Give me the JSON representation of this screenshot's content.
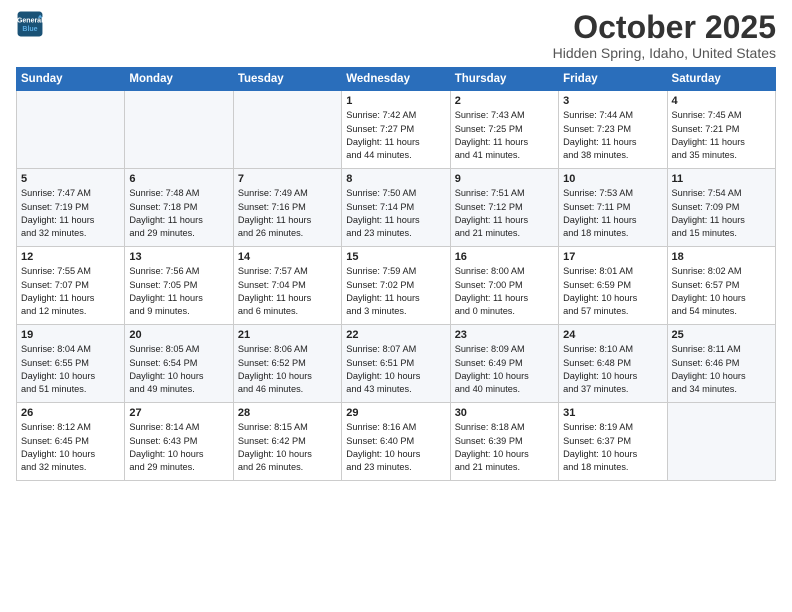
{
  "header": {
    "logo_line1": "General",
    "logo_line2": "Blue",
    "month": "October 2025",
    "location": "Hidden Spring, Idaho, United States"
  },
  "weekdays": [
    "Sunday",
    "Monday",
    "Tuesday",
    "Wednesday",
    "Thursday",
    "Friday",
    "Saturday"
  ],
  "weeks": [
    [
      {
        "day": "",
        "info": ""
      },
      {
        "day": "",
        "info": ""
      },
      {
        "day": "",
        "info": ""
      },
      {
        "day": "1",
        "info": "Sunrise: 7:42 AM\nSunset: 7:27 PM\nDaylight: 11 hours\nand 44 minutes."
      },
      {
        "day": "2",
        "info": "Sunrise: 7:43 AM\nSunset: 7:25 PM\nDaylight: 11 hours\nand 41 minutes."
      },
      {
        "day": "3",
        "info": "Sunrise: 7:44 AM\nSunset: 7:23 PM\nDaylight: 11 hours\nand 38 minutes."
      },
      {
        "day": "4",
        "info": "Sunrise: 7:45 AM\nSunset: 7:21 PM\nDaylight: 11 hours\nand 35 minutes."
      }
    ],
    [
      {
        "day": "5",
        "info": "Sunrise: 7:47 AM\nSunset: 7:19 PM\nDaylight: 11 hours\nand 32 minutes."
      },
      {
        "day": "6",
        "info": "Sunrise: 7:48 AM\nSunset: 7:18 PM\nDaylight: 11 hours\nand 29 minutes."
      },
      {
        "day": "7",
        "info": "Sunrise: 7:49 AM\nSunset: 7:16 PM\nDaylight: 11 hours\nand 26 minutes."
      },
      {
        "day": "8",
        "info": "Sunrise: 7:50 AM\nSunset: 7:14 PM\nDaylight: 11 hours\nand 23 minutes."
      },
      {
        "day": "9",
        "info": "Sunrise: 7:51 AM\nSunset: 7:12 PM\nDaylight: 11 hours\nand 21 minutes."
      },
      {
        "day": "10",
        "info": "Sunrise: 7:53 AM\nSunset: 7:11 PM\nDaylight: 11 hours\nand 18 minutes."
      },
      {
        "day": "11",
        "info": "Sunrise: 7:54 AM\nSunset: 7:09 PM\nDaylight: 11 hours\nand 15 minutes."
      }
    ],
    [
      {
        "day": "12",
        "info": "Sunrise: 7:55 AM\nSunset: 7:07 PM\nDaylight: 11 hours\nand 12 minutes."
      },
      {
        "day": "13",
        "info": "Sunrise: 7:56 AM\nSunset: 7:05 PM\nDaylight: 11 hours\nand 9 minutes."
      },
      {
        "day": "14",
        "info": "Sunrise: 7:57 AM\nSunset: 7:04 PM\nDaylight: 11 hours\nand 6 minutes."
      },
      {
        "day": "15",
        "info": "Sunrise: 7:59 AM\nSunset: 7:02 PM\nDaylight: 11 hours\nand 3 minutes."
      },
      {
        "day": "16",
        "info": "Sunrise: 8:00 AM\nSunset: 7:00 PM\nDaylight: 11 hours\nand 0 minutes."
      },
      {
        "day": "17",
        "info": "Sunrise: 8:01 AM\nSunset: 6:59 PM\nDaylight: 10 hours\nand 57 minutes."
      },
      {
        "day": "18",
        "info": "Sunrise: 8:02 AM\nSunset: 6:57 PM\nDaylight: 10 hours\nand 54 minutes."
      }
    ],
    [
      {
        "day": "19",
        "info": "Sunrise: 8:04 AM\nSunset: 6:55 PM\nDaylight: 10 hours\nand 51 minutes."
      },
      {
        "day": "20",
        "info": "Sunrise: 8:05 AM\nSunset: 6:54 PM\nDaylight: 10 hours\nand 49 minutes."
      },
      {
        "day": "21",
        "info": "Sunrise: 8:06 AM\nSunset: 6:52 PM\nDaylight: 10 hours\nand 46 minutes."
      },
      {
        "day": "22",
        "info": "Sunrise: 8:07 AM\nSunset: 6:51 PM\nDaylight: 10 hours\nand 43 minutes."
      },
      {
        "day": "23",
        "info": "Sunrise: 8:09 AM\nSunset: 6:49 PM\nDaylight: 10 hours\nand 40 minutes."
      },
      {
        "day": "24",
        "info": "Sunrise: 8:10 AM\nSunset: 6:48 PM\nDaylight: 10 hours\nand 37 minutes."
      },
      {
        "day": "25",
        "info": "Sunrise: 8:11 AM\nSunset: 6:46 PM\nDaylight: 10 hours\nand 34 minutes."
      }
    ],
    [
      {
        "day": "26",
        "info": "Sunrise: 8:12 AM\nSunset: 6:45 PM\nDaylight: 10 hours\nand 32 minutes."
      },
      {
        "day": "27",
        "info": "Sunrise: 8:14 AM\nSunset: 6:43 PM\nDaylight: 10 hours\nand 29 minutes."
      },
      {
        "day": "28",
        "info": "Sunrise: 8:15 AM\nSunset: 6:42 PM\nDaylight: 10 hours\nand 26 minutes."
      },
      {
        "day": "29",
        "info": "Sunrise: 8:16 AM\nSunset: 6:40 PM\nDaylight: 10 hours\nand 23 minutes."
      },
      {
        "day": "30",
        "info": "Sunrise: 8:18 AM\nSunset: 6:39 PM\nDaylight: 10 hours\nand 21 minutes."
      },
      {
        "day": "31",
        "info": "Sunrise: 8:19 AM\nSunset: 6:37 PM\nDaylight: 10 hours\nand 18 minutes."
      },
      {
        "day": "",
        "info": ""
      }
    ]
  ]
}
